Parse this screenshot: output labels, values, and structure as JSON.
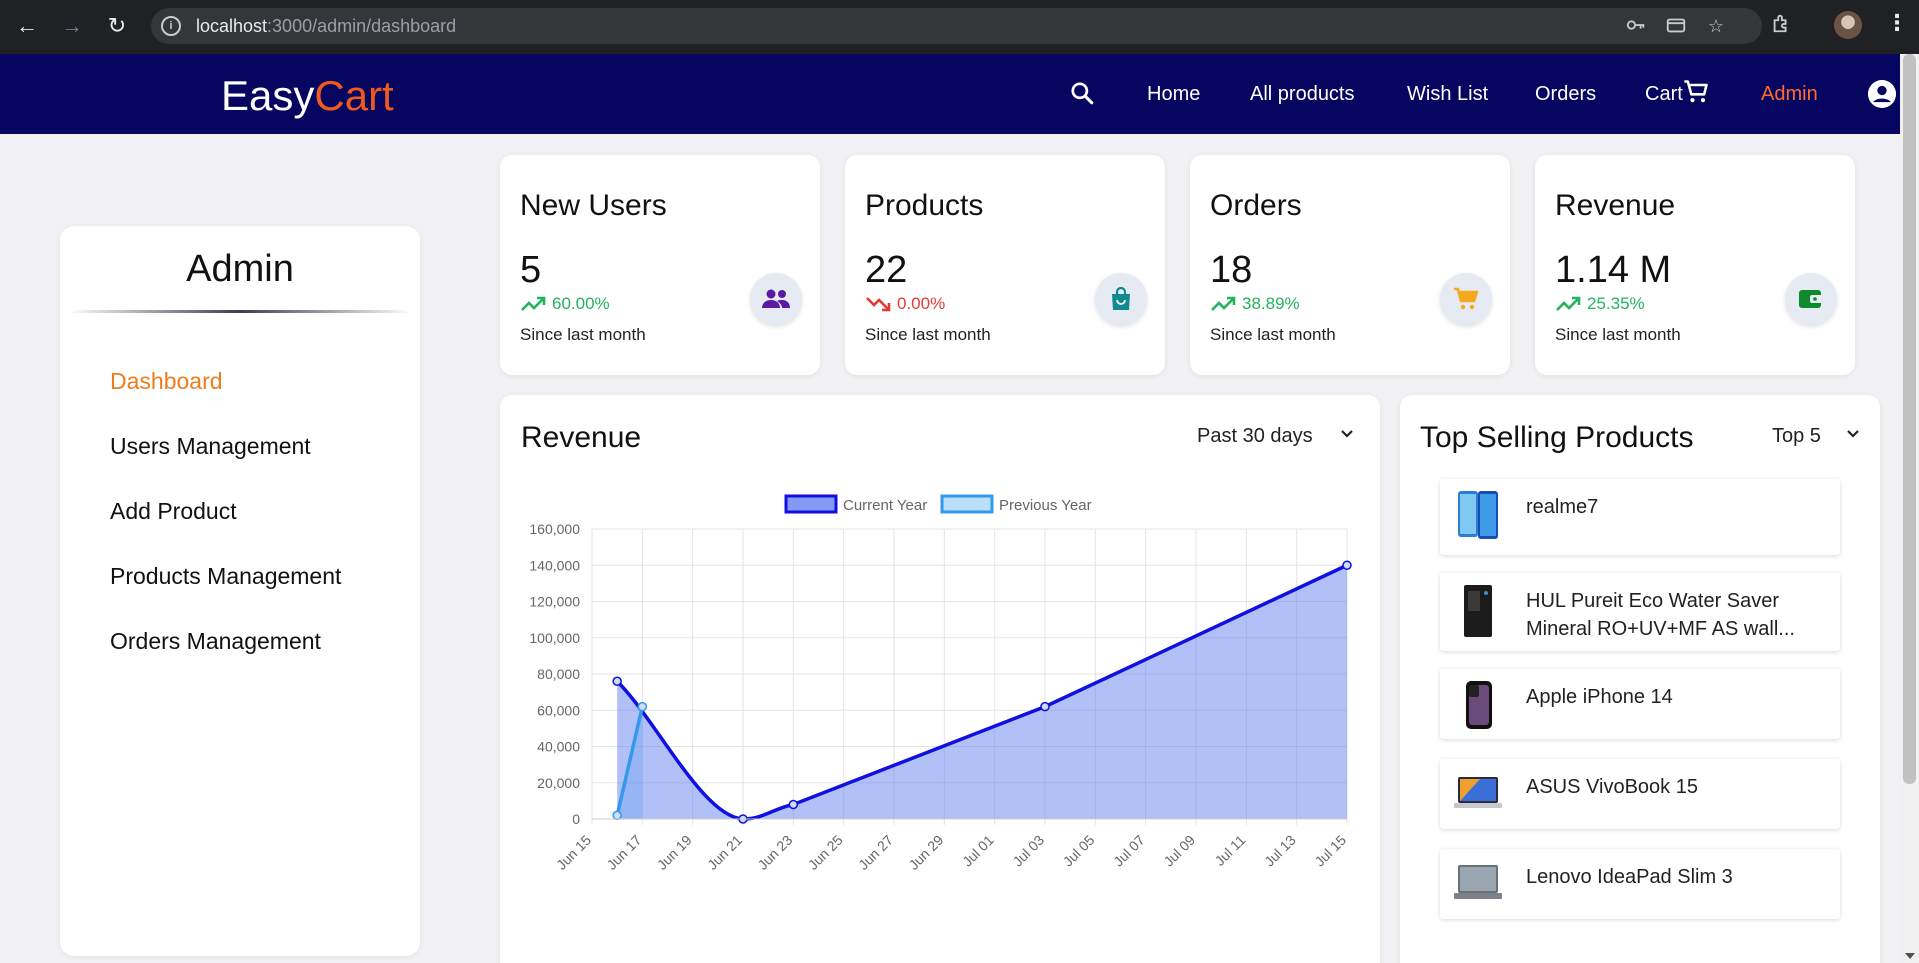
{
  "browser": {
    "url_host": "localhost",
    "url_path": ":3000/admin/dashboard"
  },
  "header": {
    "logo_part1": "Easy",
    "logo_part2": "Cart",
    "nav": {
      "home": "Home",
      "all_products": "All products",
      "wish_list": "Wish List",
      "orders": "Orders",
      "cart": "Cart",
      "admin": "Admin"
    },
    "colors": {
      "bg": "#060661",
      "accent": "#f05a1e"
    }
  },
  "sidebar": {
    "title": "Admin",
    "items": [
      {
        "label": "Dashboard",
        "active": true
      },
      {
        "label": "Users Management"
      },
      {
        "label": "Add Product"
      },
      {
        "label": "Products Management"
      },
      {
        "label": "Orders Management"
      }
    ]
  },
  "stats": [
    {
      "label": "New Users",
      "value": "5",
      "change": "60.00%",
      "direction": "up",
      "since": "Since last month",
      "icon": "users-icon",
      "icon_color": "#5b1aa3"
    },
    {
      "label": "Products",
      "value": "22",
      "change": "0.00%",
      "direction": "down",
      "since": "Since last month",
      "icon": "shopping-bag-icon",
      "icon_color": "#0f8a8f"
    },
    {
      "label": "Orders",
      "value": "18",
      "change": "38.89%",
      "direction": "up",
      "since": "Since last month",
      "icon": "shopping-cart-icon",
      "icon_color": "#f2a91e"
    },
    {
      "label": "Revenue",
      "value": "1.14 M",
      "change": "25.35%",
      "direction": "up",
      "since": "Since last month",
      "icon": "wallet-icon",
      "icon_color": "#0e8a2e"
    }
  ],
  "revenue_card": {
    "title": "Revenue",
    "period": "Past 30 days"
  },
  "chart_data": {
    "type": "line",
    "x": [
      "Jun 15",
      "Jun 17",
      "Jun 19",
      "Jun 21",
      "Jun 23",
      "Jun 25",
      "Jun 27",
      "Jun 29",
      "Jul 01",
      "Jul 03",
      "Jul 05",
      "Jul 07",
      "Jul 09",
      "Jul 11",
      "Jul 13",
      "Jul 15"
    ],
    "ylim": [
      0,
      160000
    ],
    "yticks": [
      "160,000",
      "140,000",
      "120,000",
      "100,000",
      "80,000",
      "60,000",
      "40,000",
      "20,000",
      "0"
    ],
    "series": [
      {
        "name": "Current Year",
        "color": "#1010e0",
        "fill": "rgba(100,130,240,0.5)",
        "points": [
          {
            "x": "Jun 16",
            "y": 76000
          },
          {
            "x": "Jun 21",
            "y": 0
          },
          {
            "x": "Jun 23",
            "y": 8000
          },
          {
            "x": "Jul 03",
            "y": 62000
          },
          {
            "x": "Jul 15",
            "y": 140000
          }
        ]
      },
      {
        "name": "Previous Year",
        "color": "#3498eb",
        "fill": "rgba(100,160,240,0.35)",
        "points": [
          {
            "x": "Jun 16",
            "y": 2000
          },
          {
            "x": "Jun 17",
            "y": 62000
          }
        ]
      }
    ],
    "grid": true,
    "legend": "top"
  },
  "top_selling": {
    "title": "Top Selling Products",
    "filter": "Top 5",
    "products": [
      {
        "name": "realme7",
        "thumb": "phone-blue"
      },
      {
        "name": "HUL Pureit Eco Water Saver Mineral RO+UV+MF AS wall...",
        "thumb": "water-purifier"
      },
      {
        "name": "Apple iPhone 14",
        "thumb": "phone-dark"
      },
      {
        "name": "ASUS VivoBook 15",
        "thumb": "laptop-color"
      },
      {
        "name": "Lenovo IdeaPad Slim 3",
        "thumb": "laptop-grey"
      }
    ]
  }
}
